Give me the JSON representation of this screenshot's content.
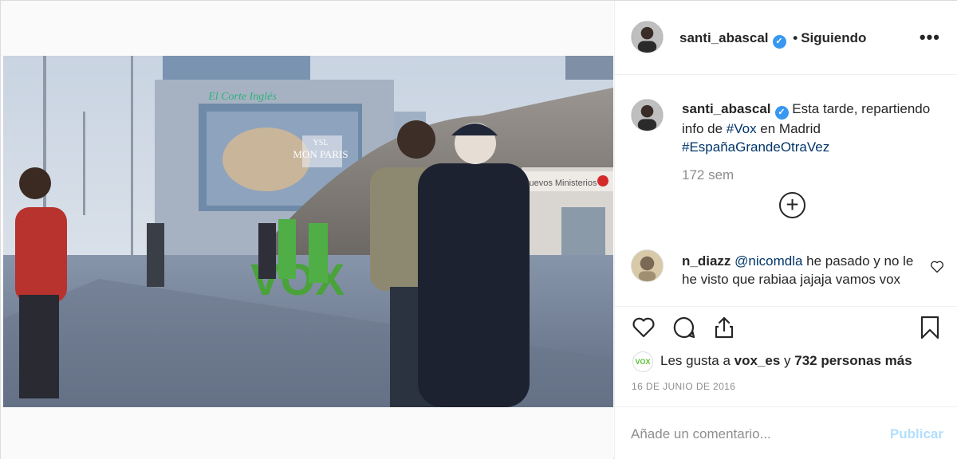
{
  "post": {
    "image_text": {
      "store_sign": "El Corte Inglés",
      "billboard_title": "MON PARIS",
      "billboard_brand": "YSL",
      "station_sign": "Nuevos Ministerios",
      "party_letters": "VOX"
    }
  },
  "header": {
    "username": "santi_abascal",
    "verified_mark": "✓",
    "separator": "•",
    "follow_label": "Siguiendo",
    "more_label": "•••"
  },
  "caption": {
    "username": "santi_abascal",
    "text_before": "Esta tarde, repartiendo info de ",
    "hashtag1": "#Vox",
    "text_middle": " en Madrid ",
    "hashtag2": "#EspañaGrandeOtraVez",
    "time": "172 sem",
    "load_more_symbol": "+"
  },
  "comment": {
    "username": "n_diazz",
    "mention": "@nicomdla",
    "text": " he pasado y no le he visto que rabiaa jajaja vamos vox"
  },
  "likes": {
    "avatar_text": "VOX",
    "prefix": "Les gusta a ",
    "user": "vox_es",
    "middle": " y ",
    "count": "732 personas más"
  },
  "date": "16 DE JUNIO DE 2016",
  "comment_input": {
    "placeholder": "Añade un comentario...",
    "value": ""
  },
  "publish_label": "Publicar",
  "colors": {
    "link": "#003569",
    "verified": "#3897f0",
    "muted": "#8e8e8e",
    "publish_disabled": "#b2dffc",
    "vox_green": "#5bc236"
  }
}
